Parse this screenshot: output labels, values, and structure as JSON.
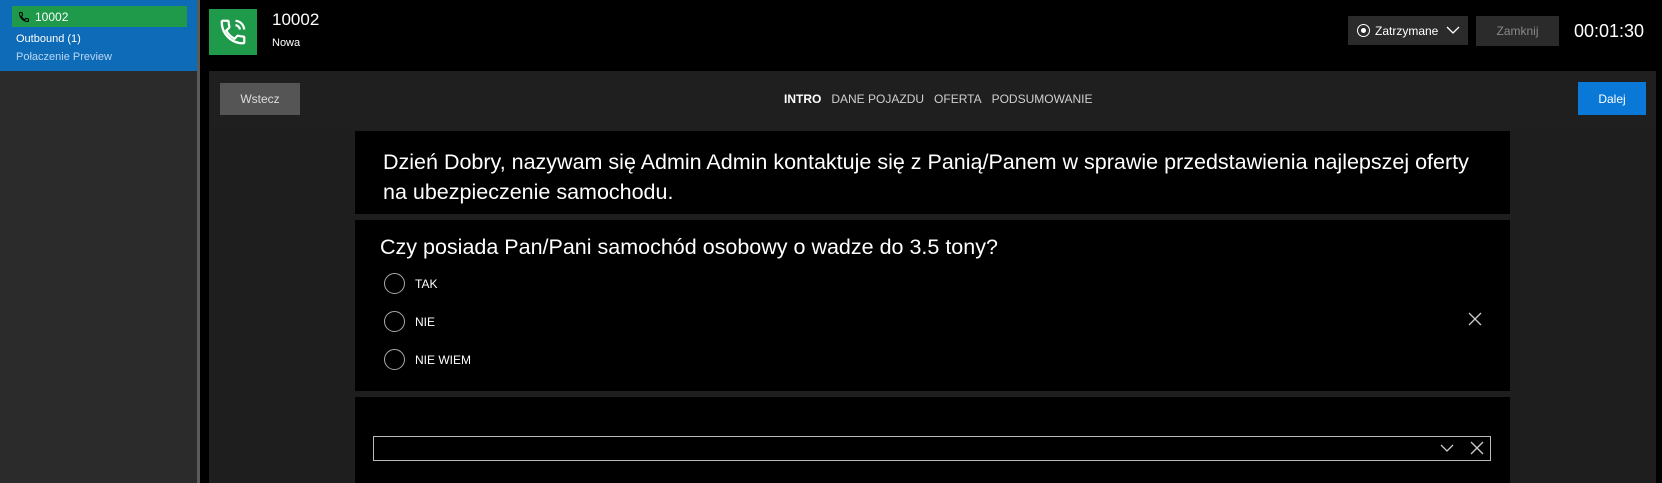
{
  "sidebar": {
    "call": {
      "number": "10002",
      "direction": "Outbound (1)",
      "type": "Połaczenie Preview"
    }
  },
  "header": {
    "number": "10002",
    "status": "Nowa",
    "state_dropdown": "Zatrzymane",
    "close_label": "Zamknij",
    "timer": "00:01:30"
  },
  "nav": {
    "back_label": "Wstecz",
    "next_label": "Dalej",
    "steps": [
      "INTRO",
      "DANE POJAZDU",
      "OFERTA",
      "PODSUMOWANIE"
    ],
    "active_step": "INTRO"
  },
  "script": {
    "intro": "Dzień Dobry, nazywam się Admin Admin kontaktuje się z Panią/Panem w sprawie przedstawienia najlepszej oferty na ubezpieczenie samochodu.",
    "question": "Czy posiada Pan/Pani samochód osobowy o wadze do 3.5 tony?",
    "options": [
      "TAK",
      "NIE",
      "NIE WIEM"
    ]
  },
  "icons": {
    "phone": "phone-icon",
    "record": "record-icon",
    "chevron": "chevron-down-icon",
    "close": "close-icon"
  },
  "colors": {
    "call_card": "#0e6bb8",
    "call_green": "#1e9a4a",
    "primary_button": "#0a78d7"
  }
}
